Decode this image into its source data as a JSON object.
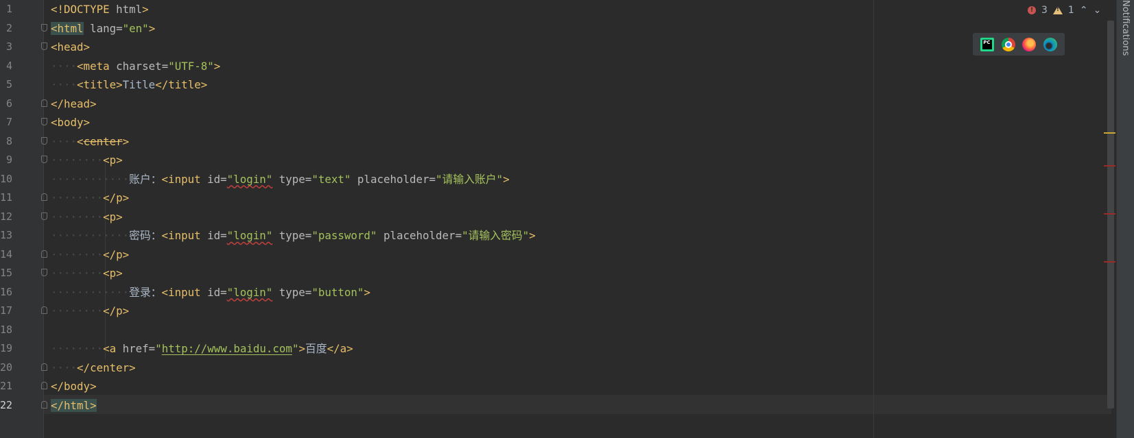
{
  "gutter": {
    "line_numbers": [
      "1",
      "2",
      "3",
      "4",
      "5",
      "6",
      "7",
      "8",
      "9",
      "10",
      "11",
      "12",
      "13",
      "14",
      "15",
      "16",
      "17",
      "18",
      "19",
      "20",
      "21",
      "22"
    ]
  },
  "code": {
    "l1": {
      "open": "<!DOCTYPE",
      "name": " html",
      "close": ">"
    },
    "l2": {
      "open": "<html",
      "attr": " lang=",
      "val": "\"en\"",
      "close": ">"
    },
    "l3": {
      "tag": "<head>"
    },
    "l4": {
      "indent": "····",
      "open": "<meta",
      "attr": " charset=",
      "val": "\"UTF-8\"",
      "close": ">"
    },
    "l5": {
      "indent": "····",
      "open": "<title>",
      "text": "Title",
      "close": "</title>"
    },
    "l6": {
      "tag": "</head>"
    },
    "l7": {
      "tag": "<body>"
    },
    "l8": {
      "indent": "····",
      "lt": "<",
      "name": "center",
      "gt": ">"
    },
    "l9": {
      "indent": "········",
      "tag": "<p>"
    },
    "l10": {
      "indent": "············",
      "label": "账户：",
      "open": "<input",
      "a1": " id=",
      "v1": "\"login\"",
      "a2": " type=",
      "v2": "\"text\"",
      "a3": " placeholder=",
      "v3": "\"请输入账户\"",
      "close": ">"
    },
    "l11": {
      "indent": "········",
      "tag": "</p>"
    },
    "l12": {
      "indent": "········",
      "tag": "<p>"
    },
    "l13": {
      "indent": "············",
      "label": "密码：",
      "open": "<input",
      "a1": " id=",
      "v1": "\"login\"",
      "a2": " type=",
      "v2": "\"password\"",
      "a3": " placeholder=",
      "v3": "\"请输入密码\"",
      "close": ">"
    },
    "l14": {
      "indent": "········",
      "tag": "</p>"
    },
    "l15": {
      "indent": "········",
      "tag": "<p>"
    },
    "l16": {
      "indent": "············",
      "label": "登录：",
      "open": "<input",
      "a1": " id=",
      "v1": "\"login\"",
      "a2": " type=",
      "v2": "\"button\"",
      "close": ">"
    },
    "l17": {
      "indent": "········",
      "tag": "</p>"
    },
    "l18": {},
    "l19": {
      "indent": "········",
      "open": "<a",
      "attr": " href=",
      "q1": "\"",
      "url": "http://www.baidu.com",
      "q2": "\"",
      "gt": ">",
      "text": "百度",
      "close": "</a>"
    },
    "l20": {
      "indent": "····",
      "tag": "</center>"
    },
    "l21": {
      "tag": "</body>"
    },
    "l22": {
      "tag": "</html>"
    }
  },
  "inspections": {
    "errors": "3",
    "warnings": "1"
  },
  "browsers": [
    "pycharm-icon",
    "chrome-icon",
    "firefox-icon",
    "edge-icon"
  ],
  "browser_pc_label": "PC",
  "right_panel": {
    "notifications_label": "Notifications"
  },
  "colors": {
    "background": "#2b2b2b",
    "tag": "#e8bf6a",
    "attr": "#bababa",
    "value": "#a5c25c",
    "text": "#a9b7c6",
    "error": "#c75450",
    "warning": "#e5c07b"
  }
}
